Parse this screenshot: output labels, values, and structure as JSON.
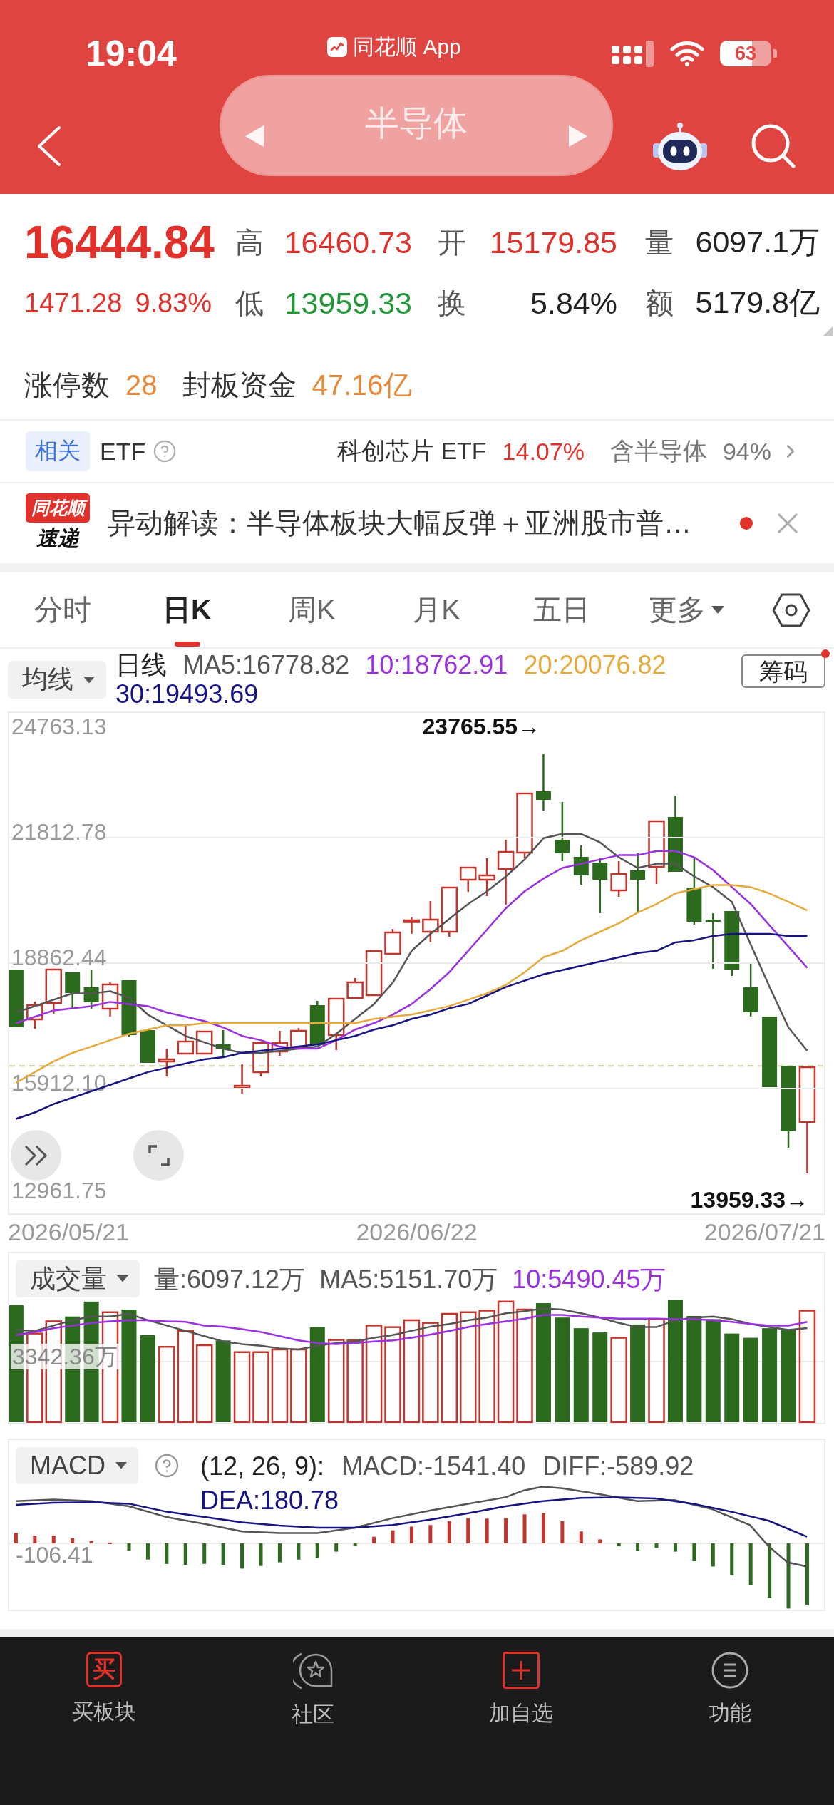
{
  "status_bar": {
    "time": "19:04",
    "app_name": "同花顺 App",
    "battery": "63"
  },
  "header": {
    "title": "半导体"
  },
  "quote": {
    "price": "16444.84",
    "change": "1471.28",
    "change_percent": "9.83%",
    "stats": [
      {
        "label": "高",
        "value": "16460.73",
        "color": "#e2312b"
      },
      {
        "label": "开",
        "value": "15179.85",
        "color": "#e2312b"
      },
      {
        "label": "量",
        "value": "6097.1万",
        "color": "#222222"
      },
      {
        "label": "低",
        "value": "13959.33",
        "color": "#23963a"
      },
      {
        "label": "换",
        "value": "5.84%",
        "color": "#222222"
      },
      {
        "label": "额",
        "value": "5179.8亿",
        "color": "#222222"
      }
    ]
  },
  "limit_up": [
    {
      "label": "涨停数",
      "value": "28"
    },
    {
      "label": "封板资金",
      "value": "47.16亿"
    }
  ],
  "etf": {
    "tag": "相关",
    "label": "ETF",
    "fund_name": "科创芯片 ETF",
    "fund_change": "14.07%",
    "holding_label": "含半导体",
    "holding_percent": "94%"
  },
  "news": {
    "badge_top": "同花顺",
    "badge_bottom": "速递",
    "text": "异动解读：半导体板块大幅反弹＋亚洲股市普…",
    "unread": true
  },
  "period_tabs": [
    {
      "label": "分时",
      "kind": "tab",
      "selected": false
    },
    {
      "label": "日K",
      "kind": "tab",
      "selected": true
    },
    {
      "label": "周K",
      "kind": "tab",
      "selected": false
    },
    {
      "label": "月K",
      "kind": "tab",
      "selected": false
    },
    {
      "label": "五日",
      "kind": "tab",
      "selected": false
    },
    {
      "label": "更多",
      "kind": "dropdown",
      "selected": false
    }
  ],
  "ma_legend": {
    "button": "均线",
    "items": [
      {
        "text": "日线",
        "color": "#222222"
      },
      {
        "text": "MA5:16778.82",
        "color": "#555555"
      },
      {
        "text": "10:18762.91",
        "color": "#9a30e0"
      },
      {
        "text": "20:20076.82",
        "color": "#e6a93c"
      },
      {
        "text": "30:19493.69",
        "color": "#161482"
      }
    ],
    "chip_button": "筹码",
    "chip_badge": true
  },
  "price_chart": {
    "chart_data": {
      "type": "line",
      "grid": true,
      "ylim": [
        12961.75,
        24763.13
      ],
      "yticks": [
        {
          "value": 24763.13,
          "label": "24763.13"
        },
        {
          "value": 21812.78,
          "label": "21812.78"
        },
        {
          "value": 18862.44,
          "label": "18862.44"
        },
        {
          "value": 15912.1,
          "label": "15912.10"
        },
        {
          "value": 12961.75,
          "label": "12961.75"
        }
      ],
      "series": [
        {
          "color": "#555555",
          "values": [
            17700,
            17850,
            18000,
            18150,
            18150,
            18200,
            18050,
            17650,
            17400,
            17150,
            17000,
            16850,
            16750,
            16750,
            16800,
            16850,
            16900,
            17200,
            17550,
            17900,
            18400,
            19150,
            19550,
            19900,
            20250,
            20550,
            20900,
            21300,
            21800,
            21900,
            21900,
            21700,
            21350,
            21100,
            21200,
            21200,
            20900,
            20650,
            20300,
            19300,
            18300,
            17350,
            16800
          ]
        },
        {
          "color": "#9a30e0",
          "values": [
            17450,
            17600,
            17750,
            17800,
            17850,
            17950,
            17900,
            17850,
            17700,
            17600,
            17500,
            17350,
            17150,
            17050,
            16900,
            16850,
            16850,
            17050,
            17300,
            17450,
            17650,
            17900,
            18250,
            18650,
            19150,
            19650,
            20150,
            20550,
            20850,
            21100,
            21200,
            21300,
            21400,
            21400,
            21500,
            21500,
            21350,
            21050,
            20650,
            20250,
            19750,
            19250,
            18750
          ]
        },
        {
          "color": "#e6a93c",
          "values": [
            16050,
            16300,
            16550,
            16750,
            16900,
            17050,
            17200,
            17300,
            17400,
            17400,
            17450,
            17450,
            17450,
            17450,
            17450,
            17450,
            17450,
            17450,
            17450,
            17550,
            17600,
            17650,
            17750,
            17850,
            18000,
            18150,
            18350,
            18650,
            19000,
            19150,
            19400,
            19600,
            19800,
            20050,
            20250,
            20500,
            20600,
            20700,
            20700,
            20650,
            20500,
            20300,
            20100
          ]
        },
        {
          "color": "#161482",
          "values": [
            15200,
            15350,
            15550,
            15700,
            15850,
            16000,
            16150,
            16300,
            16400,
            16500,
            16600,
            16650,
            16750,
            16800,
            16850,
            16900,
            16950,
            17050,
            17150,
            17300,
            17400,
            17550,
            17650,
            17800,
            17900,
            18100,
            18300,
            18450,
            18600,
            18700,
            18800,
            18900,
            19000,
            19100,
            19150,
            19350,
            19400,
            19500,
            19550,
            19550,
            19550,
            19500,
            19500
          ]
        }
      ],
      "annotations": [
        {
          "text": "23765.55→"
        },
        {
          "text": "13959.33→"
        }
      ]
    },
    "dates": [
      "2026/05/21",
      "2026/06/22",
      "2026/07/21"
    ]
  },
  "volume": {
    "button": "成交量",
    "legend": [
      {
        "text": "量:6097.12万",
        "color": "#555555"
      },
      {
        "text": "MA5:5151.70万",
        "color": "#555555"
      },
      {
        "text": "10:5490.45万",
        "color": "#9a30e0"
      }
    ],
    "y_label": "3342.36万"
  },
  "macd": {
    "button": "MACD",
    "legend": [
      {
        "text": "(12, 26, 9):",
        "color": "#222222"
      },
      {
        "text": "MACD:-1541.40",
        "color": "#555555"
      },
      {
        "text": "DIFF:-589.92",
        "color": "#555555"
      },
      {
        "text": "DEA:180.78",
        "color": "#161482"
      }
    ],
    "y_label": "-106.41"
  },
  "bottom_nav": [
    {
      "kind": "buy",
      "icon_text": "买",
      "label": "买板块"
    },
    {
      "kind": "community",
      "label": "社区"
    },
    {
      "kind": "add",
      "label": "加自选"
    },
    {
      "kind": "functions",
      "label": "功能"
    }
  ]
}
